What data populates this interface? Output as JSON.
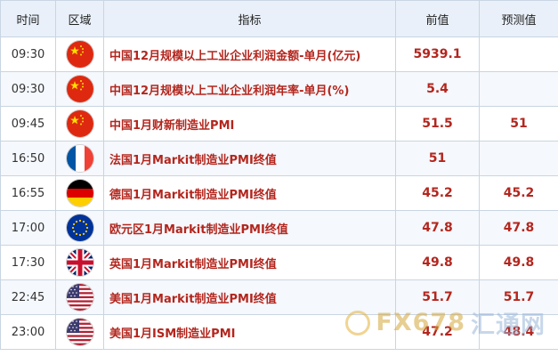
{
  "headers": {
    "time": "时间",
    "region": "区域",
    "indicator": "指标",
    "previous": "前值",
    "forecast": "预测值"
  },
  "rows": [
    {
      "time": "09:30",
      "flag": "china-flag-icon",
      "indicator": "中国12月规模以上工业企业利润金额-单月(亿元)",
      "previous": "5939.1",
      "forecast": ""
    },
    {
      "time": "09:30",
      "flag": "china-flag-icon",
      "indicator": "中国12月规模以上工业企业利润年率-单月(%)",
      "previous": "5.4",
      "forecast": ""
    },
    {
      "time": "09:45",
      "flag": "china-flag-icon",
      "indicator": "中国1月财新制造业PMI",
      "previous": "51.5",
      "forecast": "51"
    },
    {
      "time": "16:50",
      "flag": "france-flag-icon",
      "indicator": "法国1月Markit制造业PMI终值",
      "previous": "51",
      "forecast": ""
    },
    {
      "time": "16:55",
      "flag": "germany-flag-icon",
      "indicator": "德国1月Markit制造业PMI终值",
      "previous": "45.2",
      "forecast": "45.2"
    },
    {
      "time": "17:00",
      "flag": "eu-flag-icon",
      "indicator": "欧元区1月Markit制造业PMI终值",
      "previous": "47.8",
      "forecast": "47.8"
    },
    {
      "time": "17:30",
      "flag": "uk-flag-icon",
      "indicator": "英国1月Markit制造业PMI终值",
      "previous": "49.8",
      "forecast": "49.8"
    },
    {
      "time": "22:45",
      "flag": "us-flag-icon",
      "indicator": "美国1月Markit制造业PMI终值",
      "previous": "51.7",
      "forecast": "51.7"
    },
    {
      "time": "23:00",
      "flag": "us-flag-icon",
      "indicator": "美国1月ISM制造业PMI",
      "previous": "47.2",
      "forecast": "48.4"
    }
  ],
  "watermark": {
    "latin": "FX678",
    "cn": "汇通网"
  },
  "colors": {
    "value_red": "#b3261e",
    "header_bg": "#e9f0f9",
    "border": "#c9d5e3"
  }
}
